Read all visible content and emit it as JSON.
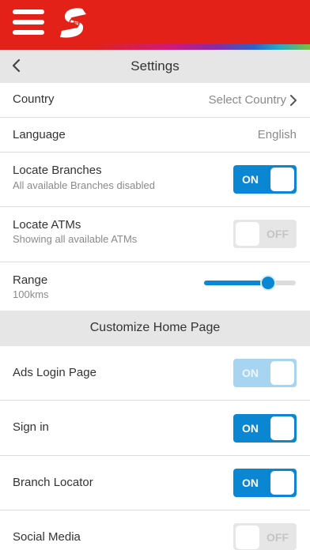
{
  "header": {
    "menu_icon": "hamburger-icon",
    "logo_icon": "scotiabank-logo-icon",
    "brand_color": "#e32119"
  },
  "subheader": {
    "back_icon": "chevron-left-icon",
    "title": "Settings"
  },
  "settings": {
    "country": {
      "label": "Country",
      "value": "Select Country",
      "icon": "chevron-right-icon"
    },
    "language": {
      "label": "Language",
      "value": "English"
    },
    "locate_branches": {
      "label": "Locate Branches",
      "sublabel": "All available Branches disabled",
      "toggle_text": "ON",
      "state": "on"
    },
    "locate_atms": {
      "label": "Locate ATMs",
      "sublabel": "Showing all available ATMs",
      "toggle_text": "OFF",
      "state": "off"
    },
    "range": {
      "label": "Range",
      "value": "100kms",
      "slider_fraction": 0.7
    }
  },
  "customize": {
    "title": "Customize Home Page",
    "items": [
      {
        "label": "Ads Login Page",
        "toggle_text": "ON",
        "state": "on-disabled"
      },
      {
        "label": "Sign in",
        "toggle_text": "ON",
        "state": "on"
      },
      {
        "label": "Branch Locator",
        "toggle_text": "ON",
        "state": "on"
      },
      {
        "label": "Social Media",
        "toggle_text": "OFF",
        "state": "off"
      }
    ]
  },
  "colors": {
    "accent_blue": "#0b86d3",
    "section_gray": "#e6e6e6"
  }
}
